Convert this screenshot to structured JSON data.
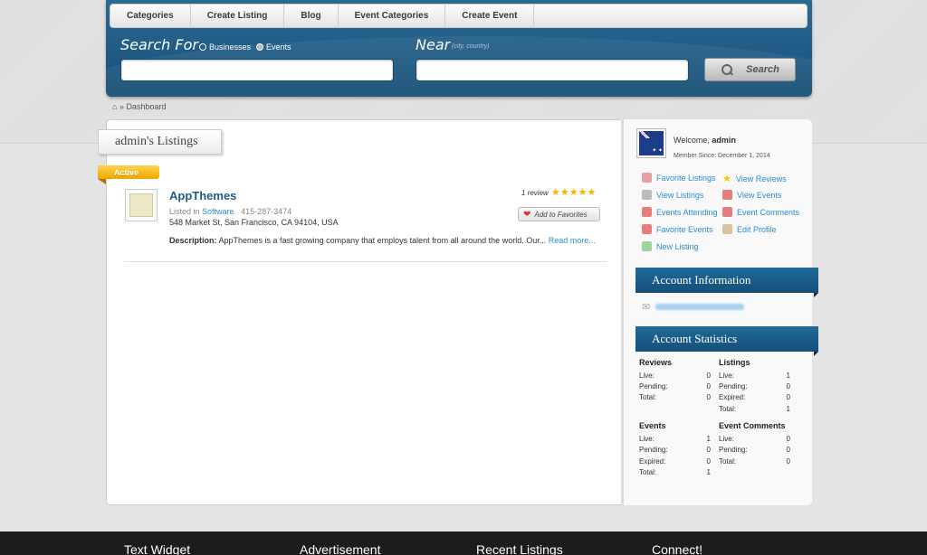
{
  "nav": [
    "Categories",
    "Create Listing",
    "Blog",
    "Event Categories",
    "Create Event"
  ],
  "search": {
    "search_for_label": "Search For",
    "radio_businesses": "Businesses",
    "radio_events": "Events",
    "near_label": "Near",
    "near_hint": "(city, country)",
    "button": "Search"
  },
  "breadcrumb": "» Dashboard",
  "page_title": "admin's Listings",
  "status": "Active",
  "listing": {
    "title": "AppThemes",
    "listed_in_prefix": "Listed in",
    "category": "Software",
    "phone": "415-287-3474",
    "address": "548 Market St, San Francisco, CA 94104, USA",
    "description_label": "Description:",
    "description": "AppThemes is a fast growing company that employs talent from all around the world. Our...",
    "read_more": "Read more...",
    "review_count": "1 review",
    "stars": "★★★★★",
    "favorite_button": "Add to Favorites"
  },
  "sidebar": {
    "welcome_prefix": "Welcome,",
    "username": "admin",
    "member_since": "Member Since: December 1, 2014",
    "links": [
      {
        "label": "Favorite Listings",
        "color": "#d9534f"
      },
      {
        "label": "View Reviews",
        "color": "#f3c300"
      },
      {
        "label": "View Listings",
        "color": "#8a8a8a"
      },
      {
        "label": "View Events",
        "color": "#d9534f"
      },
      {
        "label": "Events Attending",
        "color": "#d9534f"
      },
      {
        "label": "Event Comments",
        "color": "#d9534f"
      },
      {
        "label": "Favorite Events",
        "color": "#d9534f"
      },
      {
        "label": "Edit Profile",
        "color": "#c49a52"
      },
      {
        "label": "New Listing",
        "color": "#4caf50"
      }
    ],
    "account_info_title": "Account Information",
    "account_stats_title": "Account Statistics",
    "stats": {
      "reviews": {
        "title": "Reviews",
        "rows": [
          [
            "Live:",
            "0"
          ],
          [
            "Pending:",
            "0"
          ],
          [
            "Total:",
            "0"
          ]
        ]
      },
      "listings": {
        "title": "Listings",
        "rows": [
          [
            "Live:",
            "1"
          ],
          [
            "Pending:",
            "0"
          ],
          [
            "Expired:",
            "0"
          ],
          [
            "Total:",
            "1"
          ]
        ]
      },
      "events": {
        "title": "Events",
        "rows": [
          [
            "Live:",
            "1"
          ],
          [
            "Pending:",
            "0"
          ],
          [
            "Expired:",
            "0"
          ],
          [
            "Total:",
            "1"
          ]
        ]
      },
      "event_comments": {
        "title": "Event Comments",
        "rows": [
          [
            "Live:",
            "0"
          ],
          [
            "Pending:",
            "0"
          ],
          [
            "Total:",
            "0"
          ]
        ]
      }
    }
  },
  "footer": [
    "Text Widget",
    "Advertisement",
    "Recent Listings",
    "Connect!"
  ]
}
